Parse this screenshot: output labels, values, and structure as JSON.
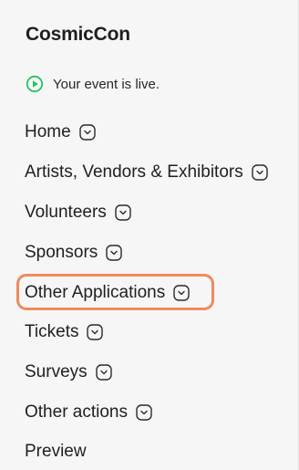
{
  "sidebar": {
    "app_title": "CosmicCon",
    "status": {
      "text": "Your event is live.",
      "icon": "play-circle-icon",
      "color": "#22c55e"
    },
    "items": [
      {
        "label": "Home",
        "has_dropdown": true
      },
      {
        "label": "Artists, Vendors & Exhibitors",
        "has_dropdown": true
      },
      {
        "label": "Volunteers",
        "has_dropdown": true
      },
      {
        "label": "Sponsors",
        "has_dropdown": true
      },
      {
        "label": "Other Applications",
        "has_dropdown": true,
        "highlighted": true
      },
      {
        "label": "Tickets",
        "has_dropdown": true
      },
      {
        "label": "Surveys",
        "has_dropdown": true
      },
      {
        "label": "Other actions",
        "has_dropdown": true
      },
      {
        "label": "Preview",
        "has_dropdown": false
      }
    ],
    "highlight_color": "#f08a5d"
  }
}
